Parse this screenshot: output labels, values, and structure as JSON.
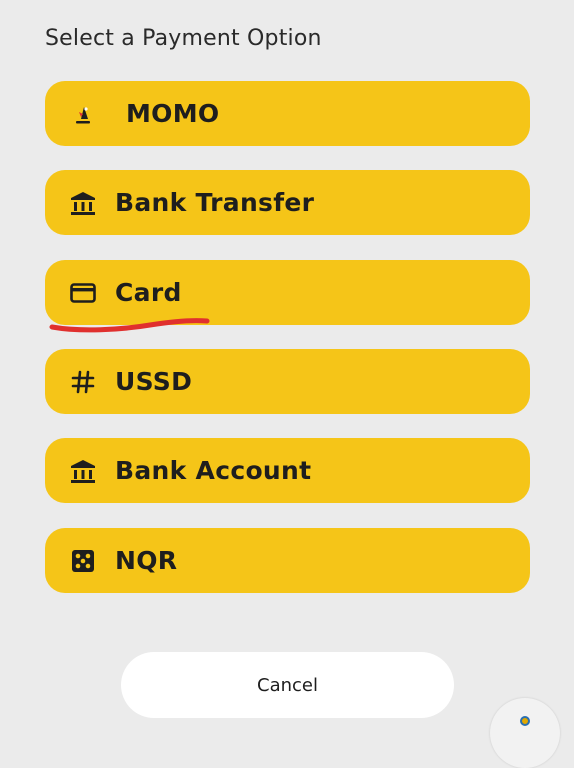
{
  "header": {
    "title": "Select a Payment Option"
  },
  "options": [
    {
      "label": "MOMO",
      "icon": "momo-logo-icon"
    },
    {
      "label": "Bank Transfer",
      "icon": "bank-icon"
    },
    {
      "label": "Card",
      "icon": "credit-card-icon"
    },
    {
      "label": "USSD",
      "icon": "hash-icon"
    },
    {
      "label": "Bank Account",
      "icon": "bank-icon"
    },
    {
      "label": "NQR",
      "icon": "qr-dice-icon"
    }
  ],
  "footer": {
    "cancel_label": "Cancel"
  },
  "colors": {
    "background": "#ebebeb",
    "option_fill": "#f5c518",
    "underline_annotation": "#e0302e"
  }
}
